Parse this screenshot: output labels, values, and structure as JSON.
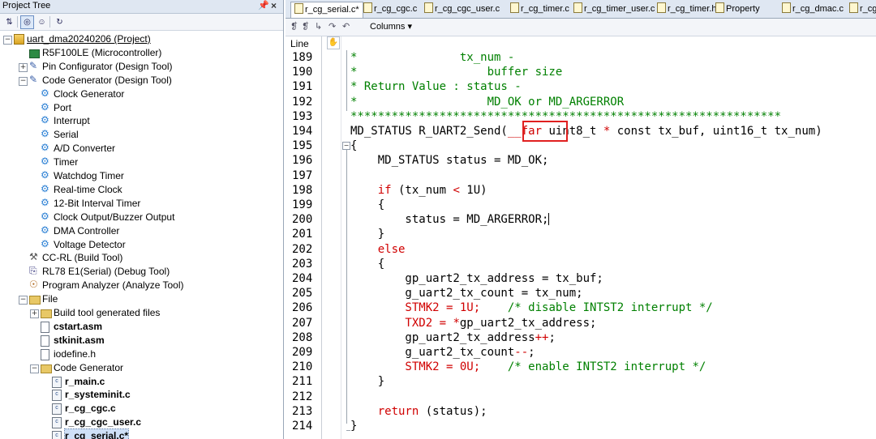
{
  "project_tree": {
    "title": "Project Tree",
    "pin_glyph": "✉",
    "close_glyph": "×",
    "items": [
      {
        "label": "uart_dma20240206 (Project)",
        "icon": "project-icon",
        "expander": "−"
      },
      {
        "label": "R5F100LE (Microcontroller)",
        "icon": "chip-icon"
      },
      {
        "label": "Pin Configurator (Design Tool)",
        "icon": "tool-icon",
        "expander": "+"
      },
      {
        "label": "Code Generator (Design Tool)",
        "icon": "tool-icon",
        "expander": "−"
      },
      {
        "label": "Clock Generator",
        "icon": "gear-icon"
      },
      {
        "label": "Port",
        "icon": "gear-icon"
      },
      {
        "label": "Interrupt",
        "icon": "gear-icon"
      },
      {
        "label": "Serial",
        "icon": "gear-icon"
      },
      {
        "label": "A/D Converter",
        "icon": "gear-icon"
      },
      {
        "label": "Timer",
        "icon": "gear-icon"
      },
      {
        "label": "Watchdog Timer",
        "icon": "gear-icon"
      },
      {
        "label": "Real-time Clock",
        "icon": "gear-icon"
      },
      {
        "label": "12-Bit Interval Timer",
        "icon": "gear-icon"
      },
      {
        "label": "Clock Output/Buzzer Output",
        "icon": "gear-icon"
      },
      {
        "label": "DMA Controller",
        "icon": "gear-icon"
      },
      {
        "label": "Voltage Detector",
        "icon": "gear-icon"
      },
      {
        "label": "CC-RL (Build Tool)",
        "icon": "hammer-icon"
      },
      {
        "label": "RL78 E1(Serial) (Debug Tool)",
        "icon": "debug-icon"
      },
      {
        "label": "Program Analyzer (Analyze Tool)",
        "icon": "analyzer-icon"
      },
      {
        "label": "File",
        "icon": "folder-icon",
        "expander": "−"
      },
      {
        "label": "Build tool generated files",
        "icon": "folder-icon",
        "expander": "+"
      },
      {
        "label": "cstart.asm",
        "icon": "file-icon"
      },
      {
        "label": "stkinit.asm",
        "icon": "file-icon"
      },
      {
        "label": "iodefine.h",
        "icon": "file-icon"
      },
      {
        "label": "Code Generator",
        "icon": "folder-icon",
        "expander": "−"
      },
      {
        "label": "r_main.c",
        "icon": "c-file-icon"
      },
      {
        "label": "r_systeminit.c",
        "icon": "c-file-icon"
      },
      {
        "label": "r_cg_cgc.c",
        "icon": "c-file-icon"
      },
      {
        "label": "r_cg_cgc_user.c",
        "icon": "c-file-icon"
      },
      {
        "label": "r_cg_serial.c*",
        "icon": "c-file-icon"
      }
    ]
  },
  "editor": {
    "tabs": [
      "r_cg_serial.c*",
      "r_cg_cgc.c",
      "r_cg_cgc_user.c",
      "r_cg_timer.c",
      "r_cg_timer_user.c",
      "r_cg_timer.h",
      "Property",
      "r_cg_dmac.c",
      "r_cg"
    ],
    "toolbar_columns": "Columns",
    "line_header": "Line",
    "lines": [
      {
        "n": "189",
        "parts": [
          {
            "t": "*               tx_num -",
            "c": "cm"
          }
        ]
      },
      {
        "n": "190",
        "parts": [
          {
            "t": "*                   buffer size",
            "c": "cm"
          }
        ]
      },
      {
        "n": "191",
        "parts": [
          {
            "t": "* Return Value : status -",
            "c": "cm"
          }
        ]
      },
      {
        "n": "192",
        "parts": [
          {
            "t": "*                   MD_OK or MD_ARGERROR",
            "c": "cm"
          }
        ]
      },
      {
        "n": "193",
        "parts": [
          {
            "t": "***************************************************************",
            "c": "cm"
          }
        ]
      },
      {
        "n": "194",
        "parts": [
          {
            "t": "MD_STATUS R_UART2_Send(",
            "c": "plain"
          },
          {
            "t": "__far",
            "c": "kw"
          },
          {
            "t": " uint8_t ",
            "c": "plain"
          },
          {
            "t": "*",
            "c": "kw"
          },
          {
            "t": " const tx_buf, uint16_t tx_num)",
            "c": "plain"
          }
        ]
      },
      {
        "n": "195",
        "parts": [
          {
            "t": "{",
            "c": "plain"
          }
        ]
      },
      {
        "n": "196",
        "parts": [
          {
            "t": "    MD_STATUS status = MD_OK;",
            "c": "plain"
          }
        ]
      },
      {
        "n": "197",
        "parts": []
      },
      {
        "n": "198",
        "parts": [
          {
            "t": "    ",
            "c": "plain"
          },
          {
            "t": "if",
            "c": "kw"
          },
          {
            "t": " (tx_num ",
            "c": "plain"
          },
          {
            "t": "<",
            "c": "kw"
          },
          {
            "t": " 1U)",
            "c": "plain"
          }
        ]
      },
      {
        "n": "199",
        "parts": [
          {
            "t": "    {",
            "c": "plain"
          }
        ]
      },
      {
        "n": "200",
        "parts": [
          {
            "t": "        status = MD_ARGERROR;",
            "c": "plain"
          }
        ]
      },
      {
        "n": "201",
        "parts": [
          {
            "t": "    }",
            "c": "plain"
          }
        ]
      },
      {
        "n": "202",
        "parts": [
          {
            "t": "    ",
            "c": "plain"
          },
          {
            "t": "else",
            "c": "kw"
          }
        ]
      },
      {
        "n": "203",
        "parts": [
          {
            "t": "    {",
            "c": "plain"
          }
        ]
      },
      {
        "n": "204",
        "parts": [
          {
            "t": "        gp_uart2_tx_address = tx_buf;",
            "c": "plain"
          }
        ]
      },
      {
        "n": "205",
        "parts": [
          {
            "t": "        g_uart2_tx_count = tx_num;",
            "c": "plain"
          }
        ]
      },
      {
        "n": "206",
        "parts": [
          {
            "t": "        STMK2 = 1U;",
            "c": "sm"
          },
          {
            "t": "    /* disable INTST2 interrupt */",
            "c": "cm"
          }
        ]
      },
      {
        "n": "207",
        "parts": [
          {
            "t": "        TXD2 = ",
            "c": "sm"
          },
          {
            "t": "*",
            "c": "kw"
          },
          {
            "t": "gp_uart2_tx_address;",
            "c": "plain"
          }
        ]
      },
      {
        "n": "208",
        "parts": [
          {
            "t": "        gp_uart2_tx_address",
            "c": "plain"
          },
          {
            "t": "++",
            "c": "kw"
          },
          {
            "t": ";",
            "c": "plain"
          }
        ]
      },
      {
        "n": "209",
        "parts": [
          {
            "t": "        g_uart2_tx_count",
            "c": "plain"
          },
          {
            "t": "--",
            "c": "kw"
          },
          {
            "t": ";",
            "c": "plain"
          }
        ]
      },
      {
        "n": "210",
        "parts": [
          {
            "t": "        STMK2 = 0U;",
            "c": "sm"
          },
          {
            "t": "    /* enable INTST2 interrupt */",
            "c": "cm"
          }
        ]
      },
      {
        "n": "211",
        "parts": [
          {
            "t": "    }",
            "c": "plain"
          }
        ]
      },
      {
        "n": "212",
        "parts": []
      },
      {
        "n": "213",
        "parts": [
          {
            "t": "    ",
            "c": "plain"
          },
          {
            "t": "return",
            "c": "kw"
          },
          {
            "t": " (status);",
            "c": "plain"
          }
        ]
      },
      {
        "n": "214",
        "parts": [
          {
            "t": "}",
            "c": "plain"
          }
        ]
      }
    ],
    "highlight_color": "#e02020",
    "comment_color": "#008000",
    "keyword_color": "#d00000"
  }
}
